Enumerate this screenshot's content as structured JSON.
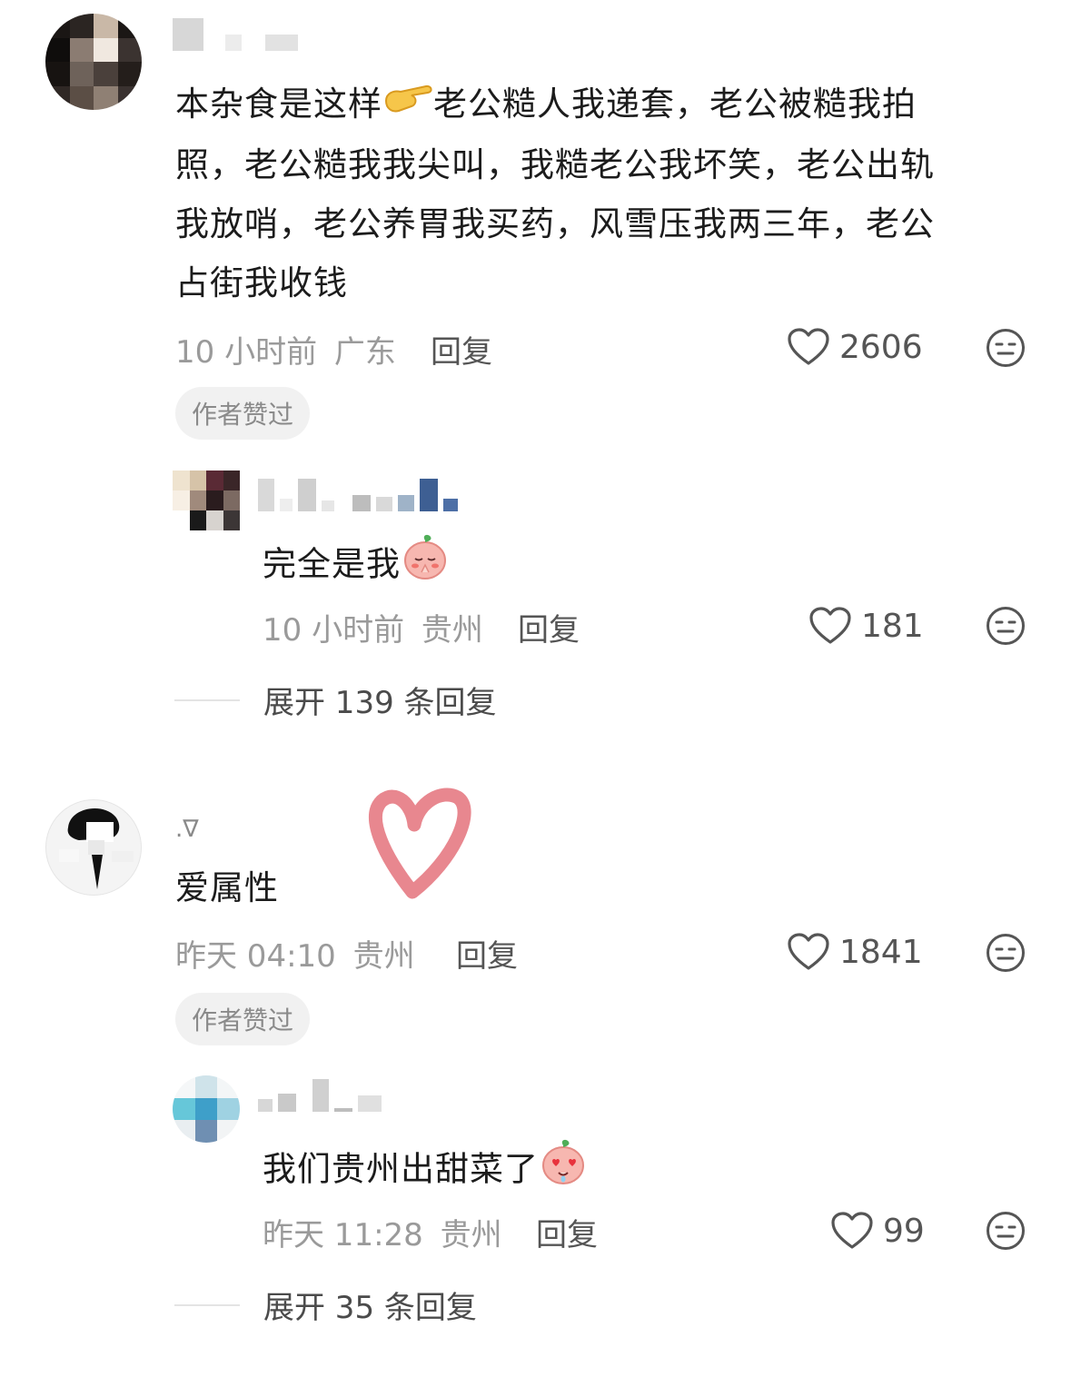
{
  "comments": [
    {
      "text": "本杂食是这样👉老公糙人我递套，老公被糙我拍照，老公糙我我尖叫，我糙老公我坏笑，老公出轨我放哨，老公养胃我买药，风雪压我两三年，老公占街我收钱",
      "line1": "本杂食是这样",
      "line1b": "老公糙人我递套，老公被糙我拍",
      "line2": "照，老公糙我我尖叫，我糙老公我坏笑，老公出轨",
      "line3": "我放哨，老公养胃我买药，风雪压我两三年，老公",
      "line4": "占街我收钱",
      "time": "10 小时前",
      "location": "广东",
      "reply_label": "回复",
      "likes": "2606",
      "badge": "作者赞过",
      "reply": {
        "text": "完全是我",
        "time": "10 小时前",
        "location": "贵州",
        "reply_label": "回复",
        "likes": "181"
      },
      "expand_label": "展开 139 条回复"
    },
    {
      "username": ".∇",
      "text": "爱属性",
      "time": "昨天 04:10",
      "location": "贵州",
      "reply_label": "回复",
      "likes": "1841",
      "badge": "作者赞过",
      "reply": {
        "text": "我们贵州出甜菜了",
        "time": "昨天 11:28",
        "location": "贵州",
        "reply_label": "回复",
        "likes": "99"
      },
      "expand_label": "展开 35 条回复"
    }
  ],
  "colors": {
    "heart_sticker": "#e8878f",
    "meta_gray": "#9a9a9a",
    "badge_bg": "#f1f1f1"
  },
  "icons": [
    "heart-outline-icon",
    "dislike-face-icon",
    "pointing-hand-emoji",
    "praying-peach-emoji",
    "heart-eyes-peach-emoji",
    "heart-sticker"
  ]
}
